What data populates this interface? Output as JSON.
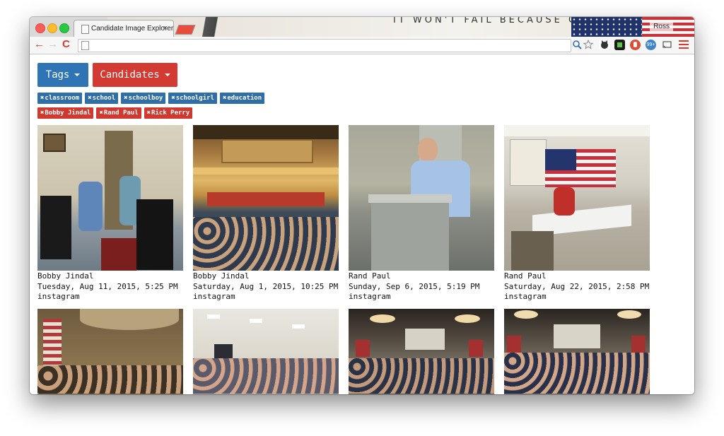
{
  "browser": {
    "tab_title": "Candidate Image Explorer",
    "tab_close": "×",
    "user_name": "Ross",
    "tabstrip_art_text": "IT WON'T FAIL BECAUSE OF ME",
    "nav_back": "←",
    "nav_forward": "→",
    "nav_reload": "C",
    "extension_badge": "99+"
  },
  "toolbar": {
    "tags_label": "Tags",
    "candidates_label": "Candidates"
  },
  "filters": {
    "tags": [
      "classroom",
      "school",
      "schoolboy",
      "schoolgirl",
      "education"
    ],
    "candidates": [
      "Bobby Jindal",
      "Rand Paul",
      "Rick Perry"
    ]
  },
  "colors": {
    "tags_blue": "#2f74b5",
    "candidates_red": "#d33a32"
  },
  "images": [
    {
      "candidate": "Bobby Jindal",
      "date": "Tuesday, Aug 11, 2015, 5:25 PM",
      "source": "instagram"
    },
    {
      "candidate": "Bobby Jindal",
      "date": "Saturday, Aug 1, 2015, 10:25 PM",
      "source": "instagram"
    },
    {
      "candidate": "Rand Paul",
      "date": "Sunday, Sep 6, 2015, 5:19 PM",
      "source": "instagram"
    },
    {
      "candidate": "Rand Paul",
      "date": "Saturday, Aug 22, 2015, 2:58 PM",
      "source": "instagram"
    },
    {
      "candidate": "",
      "date": "",
      "source": ""
    },
    {
      "candidate": "",
      "date": "",
      "source": ""
    },
    {
      "candidate": "",
      "date": "",
      "source": ""
    },
    {
      "candidate": "",
      "date": "",
      "source": ""
    }
  ]
}
